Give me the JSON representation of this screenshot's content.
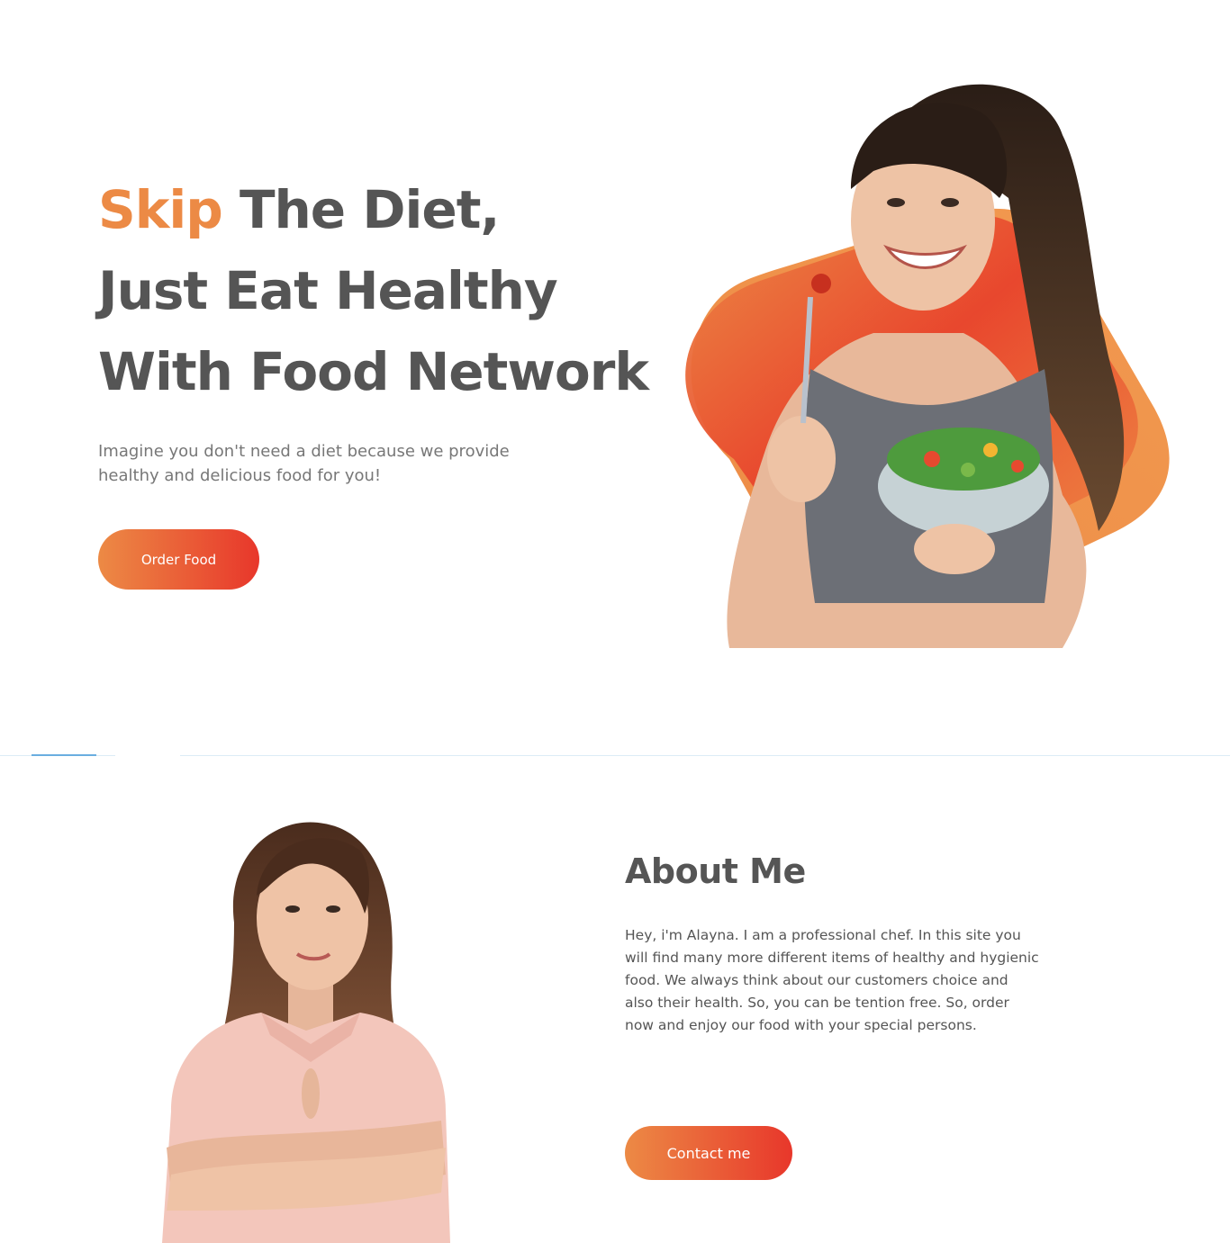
{
  "hero": {
    "title_accent": "Skip",
    "title_line1_rest": "The Diet,",
    "title_line2": "Just Eat Healthy",
    "title_line3": "With Food Network",
    "subtitle": "Imagine you don't need a diet because we provide healthy and delicious food for you!",
    "cta_label": "Order Food"
  },
  "about": {
    "title": "About Me",
    "body": "Hey, i'm Alayna. I am a professional chef. In this site you will find many more different items of healthy and hygienic food. We always think about our customers choice and also their health. So, you can be tention free. So, order now and enjoy our food with your special persons.",
    "cta_label": "Contact me"
  },
  "colors": {
    "accent_orange": "#ec8a45",
    "accent_red": "#e8372b",
    "heading": "#555555",
    "divider": "#dcecf6",
    "divider_accent": "#6aaee0"
  },
  "images": {
    "hero_image": "woman-eating-salad-photo",
    "about_image": "chef-portrait-photo"
  }
}
